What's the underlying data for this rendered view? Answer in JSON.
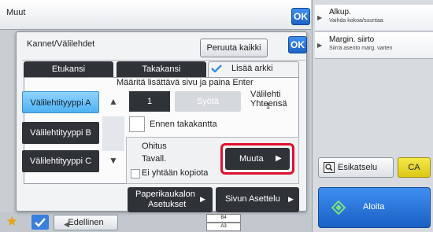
{
  "screen": {
    "title": "Muut",
    "ok_label": "OK"
  },
  "right_panel": {
    "items": [
      {
        "main": "Alkup.",
        "sub": "Vaihda kokoa/suuntaa"
      },
      {
        "main": "Margin. siirto",
        "sub": "Siirrä asento marg. varten"
      }
    ],
    "preview_label": "Esikatselu",
    "ca_label": "CA",
    "start_label": "Aloita"
  },
  "bottom_bar": {
    "previous_label": "Edellinen",
    "paper_sizes": [
      "B4",
      "A3"
    ]
  },
  "dialog": {
    "title": "Kannet/Välilehdet",
    "cancel_all_label": "Peruuta kaikki",
    "ok_label": "OK",
    "tabs": [
      {
        "label": "Etukansi"
      },
      {
        "label": "Takakansi"
      },
      {
        "label": "Lisää arkki",
        "selected": true
      }
    ],
    "instruction": "Määritä lisättävä sivu ja paina Enter",
    "types": [
      "Välilehtityyppi A",
      "Välilehtityyppi B",
      "Välilehtityyppi C"
    ],
    "selected_type": "Välilehtityyppi A",
    "page_value": "1",
    "enter_label": "Syötä",
    "tab_label": "Välilehti",
    "total_label": "Yhteensä",
    "total_count": "1",
    "before_back_cover_label": "Ennen takakantta",
    "skip_label": "Ohitus",
    "skip_value": "Tavall.",
    "no_copy_label": "Ei yhtään kopiota",
    "change_label": "Muuta",
    "paper_tray_settings_label_1": "Paperikaukalon",
    "paper_tray_settings_label_2": "Asetukset",
    "page_layout_label": "Sivun Asettelu"
  },
  "colors": {
    "accent_blue": "#1e63c4",
    "selected_type_blue": "#4fb2f2",
    "dark_button": "#2f3338",
    "highlight_red": "#e0102e",
    "ca_yellow": "#dcc817"
  }
}
